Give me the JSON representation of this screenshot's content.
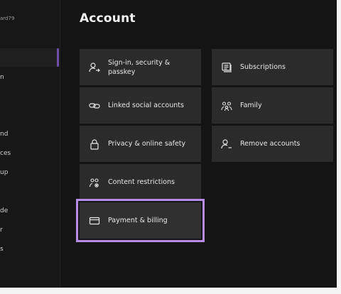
{
  "sidebar": {
    "gamertag_fragment": "ard79",
    "item_fragments": [
      "n",
      "nd",
      "ces",
      "up",
      "de",
      "r",
      "s"
    ]
  },
  "page": {
    "title": "Account"
  },
  "tiles_left": [
    {
      "id": "signin",
      "label": "Sign-in, security & passkey",
      "icon": "person-arrow-icon"
    },
    {
      "id": "linked",
      "label": "Linked social accounts",
      "icon": "link-icon"
    },
    {
      "id": "privacy",
      "label": "Privacy & online safety",
      "icon": "lock-icon"
    },
    {
      "id": "content",
      "label": "Content restrictions",
      "icon": "family-settings-icon"
    },
    {
      "id": "payment",
      "label": "Payment & billing",
      "icon": "card-icon"
    }
  ],
  "tiles_right": [
    {
      "id": "subscriptions",
      "label": "Subscriptions",
      "icon": "subscriptions-icon"
    },
    {
      "id": "family",
      "label": "Family",
      "icon": "family-icon"
    },
    {
      "id": "remove",
      "label": "Remove accounts",
      "icon": "person-minus-icon"
    }
  ],
  "colors": {
    "background": "#141414",
    "tile": "#2b2b2b",
    "focus_outline": "#b78be6",
    "accent": "#6e50a6"
  }
}
